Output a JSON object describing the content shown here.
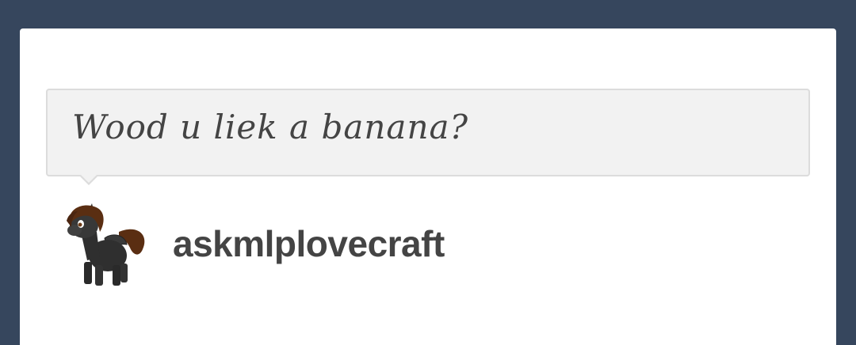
{
  "ask": {
    "question": "Wood u liek a banana?",
    "asker_name": "askmlplovecraft",
    "avatar_icon": "pony-avatar-icon"
  },
  "colors": {
    "dashboard_background": "#36465d",
    "card_background": "#ffffff",
    "bubble_background": "#f2f2f2",
    "bubble_border": "#dcdcdc",
    "text": "#444444"
  }
}
